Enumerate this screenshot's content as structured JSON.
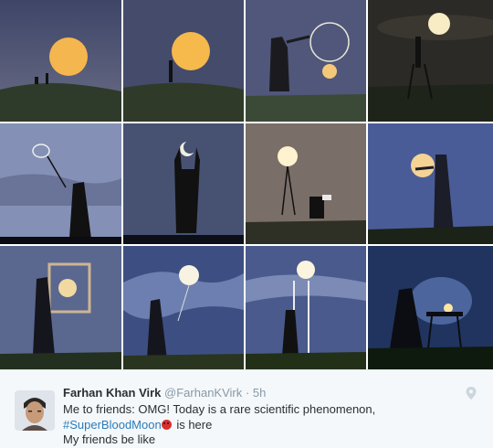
{
  "tweet": {
    "display_name": "Farhan Khan Virk",
    "handle": "@FarhanKVirk",
    "separator": "·",
    "time": "5h",
    "text_line1": "Me to friends: OMG! Today is a rare scientific phenomenon,",
    "hashtag": "#SuperBloodMoon",
    "emoji_icon": "angry-face-icon",
    "text_line2_rest": " is here",
    "text_line3": "My friends be like"
  },
  "icons": {
    "location": "location-pin-icon"
  },
  "colors": {
    "hashtag": "#2b7bb9",
    "name": "#292f33",
    "meta": "#8899a6",
    "tweet_bg": "#f5f8fa"
  }
}
